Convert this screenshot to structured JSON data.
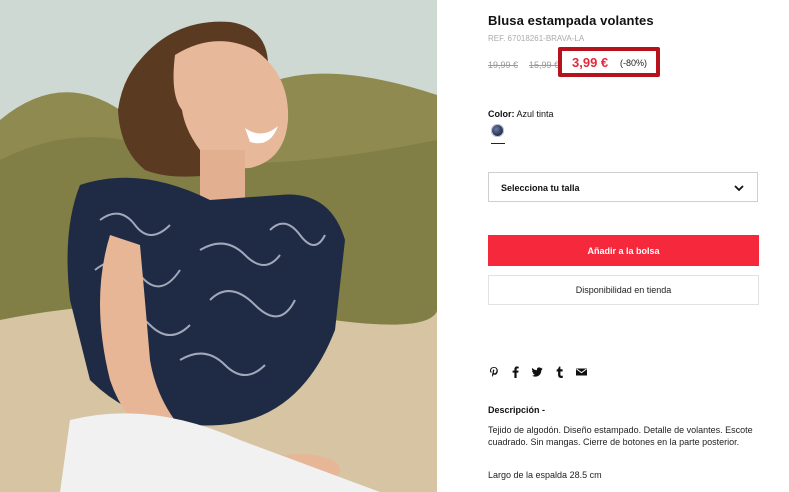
{
  "product": {
    "title": "Blusa estampada volantes",
    "ref": "REF. 67018261-BRAVA-LA",
    "old_price_1": "19,99 €",
    "old_price_2": "15,99 €",
    "current_price": "3,99 €",
    "discount": "(-80%)"
  },
  "color": {
    "label": "Color:",
    "value": "Azul tinta",
    "swatch_color": "#2b3555"
  },
  "size_select": {
    "value": "Selecciona tu talla",
    "icon": "chevron-down-icon"
  },
  "buttons": {
    "add_to_bag": "Añadir a la bolsa",
    "store_availability": "Disponibilidad en tienda"
  },
  "share_icons": [
    "pinterest-icon",
    "facebook-icon",
    "twitter-icon",
    "tumblr-icon",
    "email-icon"
  ],
  "description": {
    "heading": "Descripción -",
    "text": "Tejido de algodón. Diseño estampado. Detalle de volantes. Escote cuadrado. Sin mangas. Cierre de botones en la parte posterior.",
    "extra": "Largo de la espalda 28.5 cm"
  },
  "colors": {
    "accent": "#f6283c",
    "highlight_border": "#b5121b",
    "sale_price": "#e4283a"
  }
}
